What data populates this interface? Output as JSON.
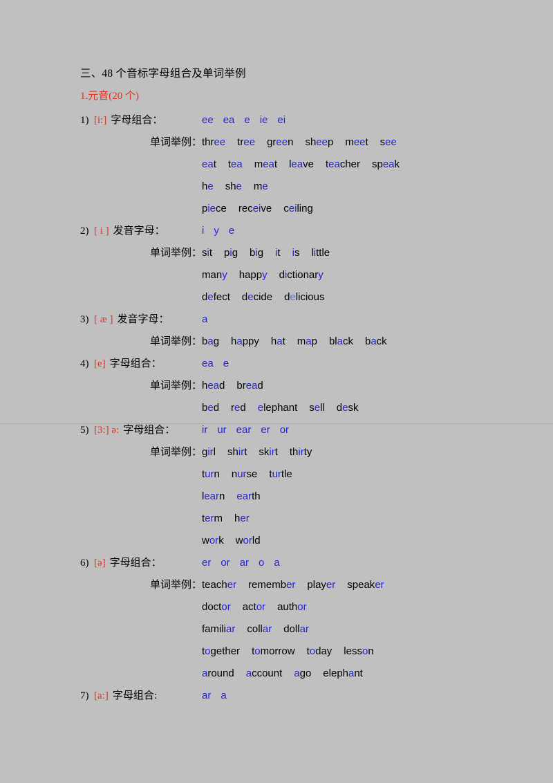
{
  "document": {
    "title": "三、48 个音标字母组合及单词举例",
    "subtitle": "1.元音(20 个)",
    "labels": {
      "letter_combination": "字母组合：",
      "pronounced_letters": "发音字母：",
      "word_examples": "单词举例："
    },
    "colors": {
      "background": "#c0c0c0",
      "text": "#000000",
      "ipa_red": "#e03020",
      "highlight_blue": "#2222dd"
    }
  },
  "sections": [
    {
      "number": "1)",
      "ipa": "[i:]",
      "head_label": "字母组合：",
      "combinations": [
        "ee",
        "ea",
        "e",
        "ie",
        "ei"
      ],
      "examples_label": "单词举例：",
      "example_rows": [
        [
          "three",
          "tree",
          "green",
          "sheep",
          "meet",
          "see"
        ],
        [
          "eat",
          "tea",
          "meat",
          "leave",
          "teacher",
          "speak"
        ],
        [
          "he",
          "she",
          "me"
        ],
        [
          "piece",
          "receive",
          "ceiling"
        ]
      ]
    },
    {
      "number": "2)",
      "ipa": "[ i ]",
      "head_label": "发音字母：",
      "combinations": [
        "i",
        "y",
        "e"
      ],
      "examples_label": "单词举例：",
      "example_rows": [
        [
          "sit",
          "pig",
          "big",
          "it",
          "is",
          "little"
        ],
        [
          "many",
          "happy",
          "dictionary"
        ],
        [
          "defect",
          "decide",
          "delicious"
        ]
      ]
    },
    {
      "number": "3)",
      "ipa": "[ æ ]",
      "head_label": "发音字母：",
      "combinations": [
        "a"
      ],
      "examples_label": "单词举例：",
      "example_rows": [
        [
          "bag",
          "happy",
          "hat",
          "map",
          "black",
          "back"
        ]
      ]
    },
    {
      "number": "4)",
      "ipa": "[e]",
      "head_label": "字母组合：",
      "combinations": [
        "ea",
        "e"
      ],
      "examples_label": "单词举例：",
      "example_rows": [
        [
          "head",
          "bread"
        ],
        [
          "bed",
          "red",
          "elephant",
          "sell",
          "desk"
        ]
      ]
    },
    {
      "number": "5)",
      "ipa": "[3:] ə:",
      "head_label": "字母组合：",
      "combinations": [
        "ir",
        "ur",
        "ear",
        "er",
        "or"
      ],
      "examples_label": "单词举例：",
      "example_rows": [
        [
          "girl",
          "shirt",
          "skirt",
          "thirty"
        ],
        [
          "turn",
          "nurse",
          "turtle"
        ],
        [
          "learn",
          "earth"
        ],
        [
          "term",
          "her"
        ],
        [
          "work",
          "world"
        ]
      ]
    },
    {
      "number": "6)",
      "ipa": "[ə]",
      "head_label": "字母组合：",
      "combinations": [
        "er",
        "or",
        "ar",
        "o",
        "a"
      ],
      "examples_label": "单词举例：",
      "example_rows": [
        [
          "teacher",
          "remember",
          "player",
          "speaker"
        ],
        [
          "doctor",
          "actor",
          "author"
        ],
        [
          "familiar",
          "collar",
          "dollar"
        ],
        [
          "together",
          "tomorrow",
          "today",
          "lesson"
        ],
        [
          "around",
          "account",
          "ago",
          "elephant"
        ]
      ]
    },
    {
      "number": "7)",
      "ipa": "[a:]",
      "head_label": "字母组合:",
      "combinations": [
        "ar",
        "a"
      ],
      "examples_label": "",
      "example_rows": []
    }
  ],
  "word_highlights": {
    "three": [
      3,
      5
    ],
    "tree": [
      2,
      4
    ],
    "green": [
      2,
      4
    ],
    "sheep": [
      2,
      4
    ],
    "meet": [
      1,
      3
    ],
    "see": [
      1,
      3
    ],
    "eat": [
      0,
      2
    ],
    "tea": [
      1,
      3
    ],
    "meat": [
      1,
      3
    ],
    "leave": [
      1,
      3
    ],
    "teacher": [
      1,
      3
    ],
    "speak": [
      2,
      4
    ],
    "he": [
      1,
      2
    ],
    "she": [
      2,
      3
    ],
    "me": [
      1,
      2
    ],
    "piece": [
      1,
      3
    ],
    "receive": [
      3,
      5
    ],
    "ceiling": [
      1,
      3
    ],
    "sit": [
      1,
      2
    ],
    "pig": [
      1,
      2
    ],
    "big": [
      1,
      2
    ],
    "it": [
      0,
      1
    ],
    "is": [
      0,
      1
    ],
    "little": [
      1,
      2
    ],
    "many": [
      3,
      4
    ],
    "happy": [
      4,
      5
    ],
    "dictionary": [
      1,
      2
    ],
    "defect": [
      1,
      2
    ],
    "decide": [
      1,
      2
    ],
    "delicious": [
      1,
      2
    ],
    "bag": [
      1,
      2
    ],
    "hat": [
      1,
      2
    ],
    "map": [
      1,
      2
    ],
    "black": [
      2,
      3
    ],
    "back": [
      1,
      2
    ],
    "head": [
      1,
      3
    ],
    "bread": [
      2,
      4
    ],
    "bed": [
      1,
      2
    ],
    "red": [
      1,
      2
    ],
    "elephant": [
      0,
      1
    ],
    "sell": [
      1,
      2
    ],
    "desk": [
      1,
      2
    ],
    "girl": [
      1,
      3
    ],
    "shirt": [
      2,
      4
    ],
    "skirt": [
      2,
      4
    ],
    "thirty": [
      2,
      4
    ],
    "turn": [
      1,
      3
    ],
    "nurse": [
      1,
      3
    ],
    "turtle": [
      1,
      3
    ],
    "learn": [
      1,
      4
    ],
    "earth": [
      0,
      3
    ],
    "term": [
      1,
      3
    ],
    "her": [
      1,
      3
    ],
    "work": [
      1,
      3
    ],
    "world": [
      1,
      3
    ],
    "remember": [
      6,
      8
    ],
    "player": [
      4,
      6
    ],
    "speaker": [
      5,
      7
    ],
    "doctor": [
      4,
      6
    ],
    "actor": [
      3,
      5
    ],
    "author": [
      4,
      6
    ],
    "familiar": [
      6,
      8
    ],
    "collar": [
      4,
      6
    ],
    "dollar": [
      4,
      6
    ],
    "together": [
      1,
      2
    ],
    "tomorrow": [
      1,
      2
    ],
    "today": [
      1,
      2
    ],
    "lesson": [
      4,
      5
    ],
    "around": [
      0,
      1
    ],
    "account": [
      0,
      1
    ],
    "ago": [
      0,
      1
    ]
  },
  "word_highlight_overrides": {
    "dictionary": [
      [
        1,
        2
      ],
      [
        9,
        10
      ]
    ],
    "happy_ae": [
      [
        1,
        2
      ]
    ],
    "teacher_e": [
      [
        1,
        3
      ]
    ],
    "teacher_schwa": [
      [
        5,
        7
      ]
    ],
    "elephant_schwa": [
      [
        5,
        6
      ]
    ],
    "many_i": [
      [
        3,
        4
      ]
    ],
    "happy_i": [
      [
        4,
        5
      ]
    ]
  }
}
